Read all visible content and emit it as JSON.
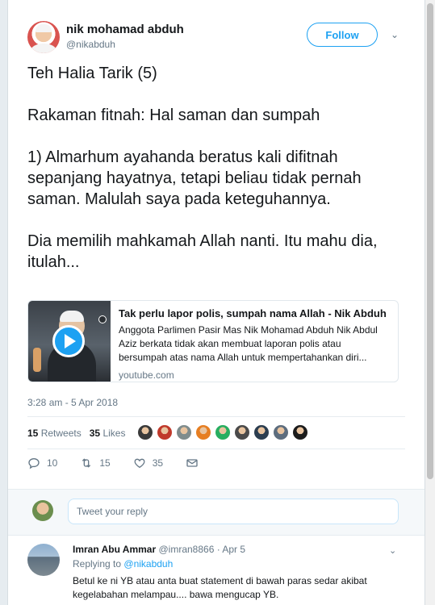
{
  "tweet": {
    "display_name": "nik mohamad abduh",
    "handle": "@nikabduh",
    "follow_label": "Follow",
    "paragraphs": [
      "Teh Halia Tarik (5)",
      "Rakaman fitnah: Hal saman dan sumpah",
      "1) Almarhum ayahanda beratus kali difitnah sepanjang hayatnya, tetapi beliau tidak pernah saman. Malulah saya pada keteguhannya.",
      "Dia memilih mahkamah Allah nanti. Itu mahu dia, itulah..."
    ],
    "timestamp": "3:28 am - 5 Apr 2018"
  },
  "link_card": {
    "title": "Tak perlu lapor polis, sumpah nama Allah - Nik Abduh",
    "description": "Anggota Parlimen Pasir Mas Nik Mohamad Abduh Nik Abdul Aziz berkata tidak akan membuat laporan polis atau bersumpah atas nama Allah untuk mempertahankan diri...",
    "domain": "youtube.com"
  },
  "stats": {
    "retweets_count": "15",
    "retweets_label": "Retweets",
    "likes_count": "35",
    "likes_label": "Likes"
  },
  "likers": [
    "#3a3a3a",
    "#c0392b",
    "#7f8c8d",
    "#e67e22",
    "#27ae60",
    "#4a4a4a",
    "#2c3e50",
    "#5d6d7e",
    "#1c1c1c"
  ],
  "actions": {
    "reply_count": "10",
    "retweet_count": "15",
    "like_count": "35"
  },
  "compose": {
    "placeholder": "Tweet your reply"
  },
  "reply": {
    "name": "Imran Abu Ammar",
    "handle_date": "@imran8866 · Apr 5",
    "replying_prefix": "Replying to",
    "replying_to": "@nikabduh",
    "text": "Betul ke ni YB atau anta buat statement di bawah paras sedar akibat kegelabahan melampau.... bawa mengucap YB."
  },
  "colors": {
    "accent": "#1da1f2",
    "secondary_text": "#657786",
    "page_background": "#e6ecf0"
  }
}
